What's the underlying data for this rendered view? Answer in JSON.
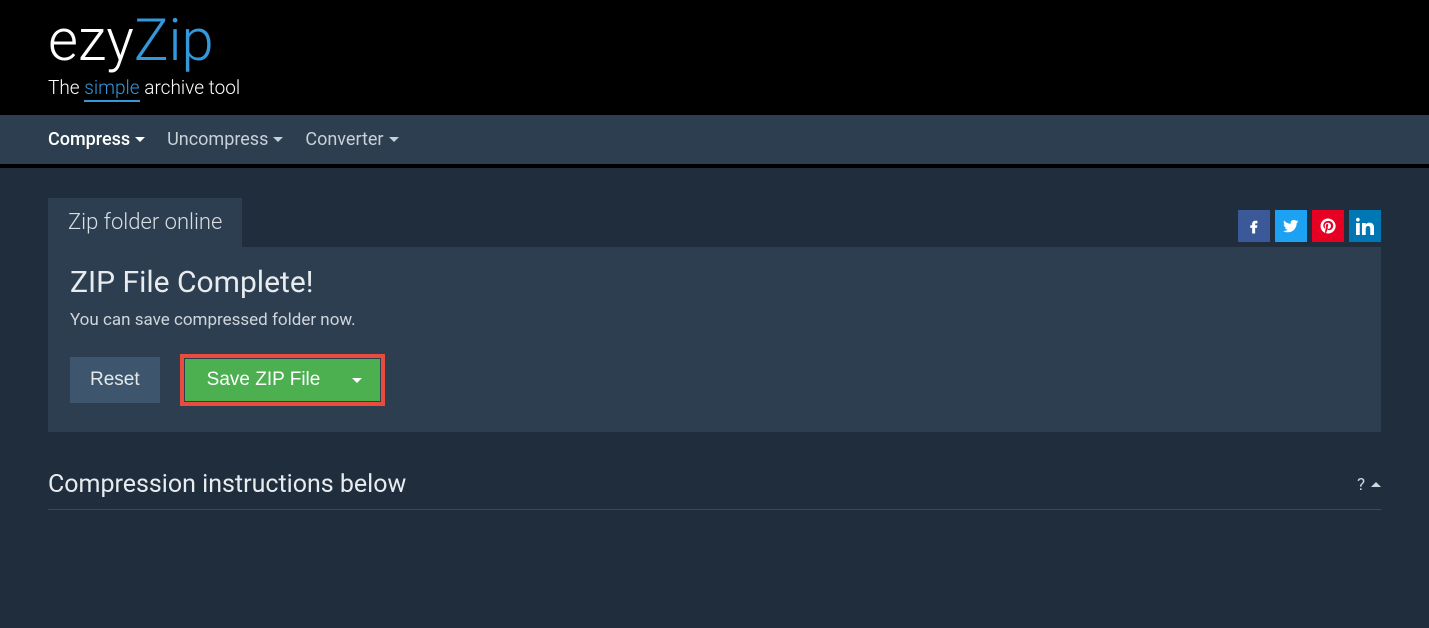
{
  "brand": {
    "part1": "ezy",
    "part2": "Zip",
    "tagline_pre": "The ",
    "tagline_highlight": "simple",
    "tagline_post": " archive tool"
  },
  "nav": {
    "compress": "Compress",
    "uncompress": "Uncompress",
    "converter": "Converter"
  },
  "tab": {
    "label": "Zip folder online"
  },
  "panel": {
    "heading": "ZIP File Complete!",
    "subtext": "You can save compressed folder now."
  },
  "buttons": {
    "reset": "Reset",
    "save": "Save ZIP File"
  },
  "instructions": {
    "heading": "Compression instructions below",
    "help": "?"
  },
  "social": {
    "facebook": "facebook",
    "twitter": "twitter",
    "pinterest": "pinterest",
    "linkedin": "linkedin"
  }
}
